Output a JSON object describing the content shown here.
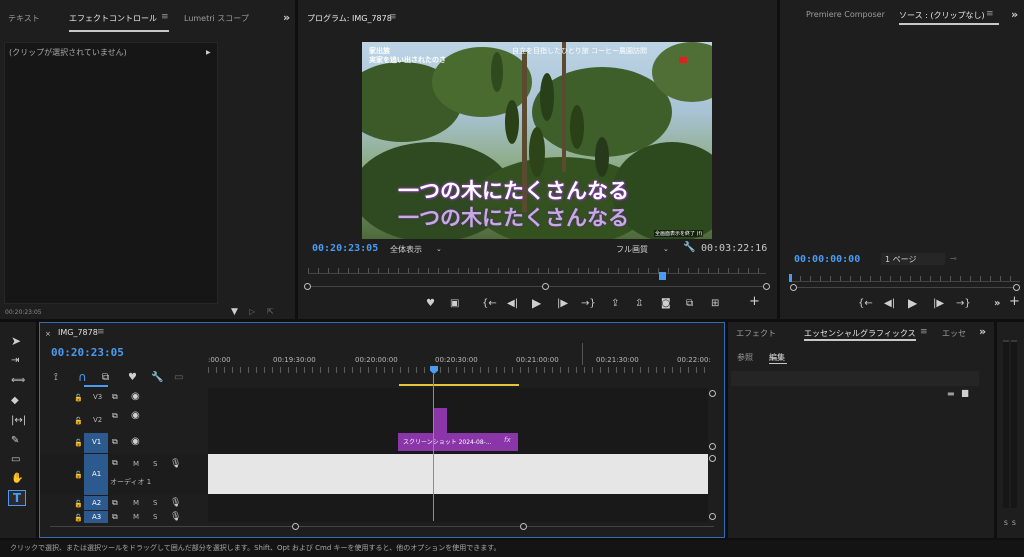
{
  "colors": {
    "accent_blue": "#4a9bf2",
    "clip_purple": "#8a35a8",
    "work_area_yellow": "#e2c53c",
    "audio_clip": "#e6e6e6",
    "track_blue": "#2d5a8e"
  },
  "left_panel": {
    "tabs": [
      "テキスト",
      "エフェクトコントロール",
      "Lumetri スコープ"
    ],
    "empty_message": "(クリップが選択されていません)",
    "timecode": "00:20:23:05"
  },
  "program_monitor": {
    "title": "プログラム: IMG_7878",
    "video": {
      "caption_top_left_1": "家出族",
      "caption_top_left_2": "実家を追い出されたのさ",
      "caption_top_right": "自立を目指したひとり旅 コーヒー農園訪問",
      "subtitle_1": "一つの木にたくさんなる",
      "subtitle_2": "一つの木にたくさんなる",
      "exit_fullscreen": "全画面表示を終了 (f)"
    },
    "timecode_current": "00:20:23:05",
    "zoom_label": "全体表示",
    "quality_label": "フル画質",
    "timecode_duration": "00:03:22:16"
  },
  "source_monitor": {
    "tabs": [
      "Premiere Composer",
      "ソース : (クリップなし)"
    ],
    "timecode": "00:00:00:00",
    "page_label": "1 ページ"
  },
  "timeline": {
    "sequence_name": "IMG_7878",
    "timecode": "00:20:23:05",
    "ruler_labels": [
      ":00:00",
      "00:19:30:00",
      "00:20:00:00",
      "00:20:30:00",
      "00:21:00:00",
      "00:21:30:00",
      "00:22:00:"
    ],
    "video_tracks": [
      "V3",
      "V2",
      "V1"
    ],
    "audio_tracks": [
      "A1",
      "A2",
      "A3"
    ],
    "audio_track_label": "オーディオ 1",
    "clip_name": "スクリーンショット 2024-08-...",
    "fx_label": "fx",
    "mute_label": "M",
    "solo_label": "S"
  },
  "essential_graphics": {
    "tabs": [
      "エフェクト",
      "エッセンシャルグラフィックス",
      "エッセ"
    ],
    "subtabs": [
      "参照",
      "編集"
    ]
  },
  "meter": {
    "solo_labels": [
      "S",
      "S"
    ]
  },
  "status_bar": {
    "text": "クリックで選択、または選択ツールをドラッグして囲んだ部分を選択します。Shift、Opt および Cmd キーを使用すると、他のオプションを使用できます。"
  }
}
